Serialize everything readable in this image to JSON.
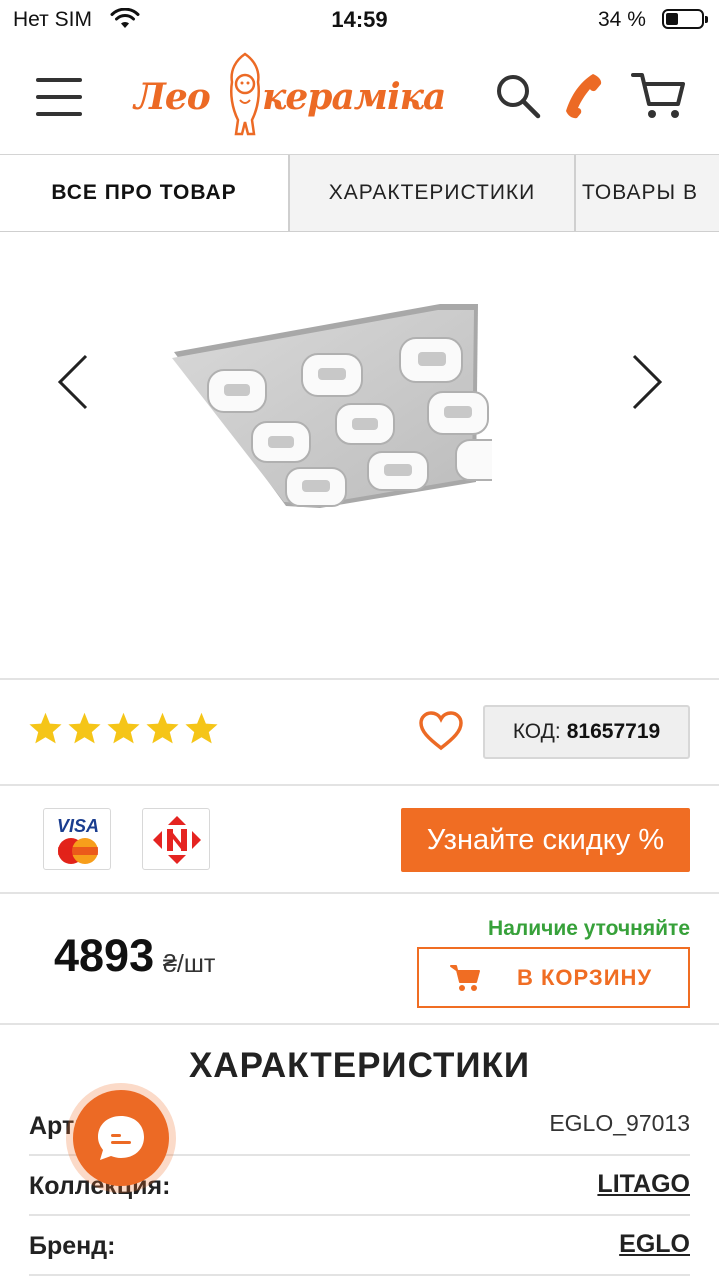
{
  "status_bar": {
    "carrier": "Нет SIM",
    "time": "14:59",
    "battery_percent": "34 %",
    "battery_level": 0.34
  },
  "header": {
    "logo_left": "Лео",
    "logo_right": "кераміка",
    "icons": [
      "menu-icon",
      "search-icon",
      "phone-icon",
      "cart-icon"
    ],
    "brand_color": "#ec6a25"
  },
  "tabs": [
    {
      "label": "ВСЕ ПРО ТОВАР",
      "active": true
    },
    {
      "label": "ХАРАКТЕРИСТИКИ",
      "active": false
    },
    {
      "label": "ТОВАРЫ В",
      "active": false
    }
  ],
  "gallery": {
    "prev_icon": "chevron-left-icon",
    "next_icon": "chevron-right-icon"
  },
  "product": {
    "rating": 5,
    "rating_max": 5,
    "star_color": "#f5c518",
    "code_label": "КОД:",
    "code_value": "81657719",
    "discount_label": "Узнайте скидку %",
    "price": "4893",
    "price_unit": "₴/шт",
    "availability": "Наличие уточняйте",
    "availability_color": "#37a13a",
    "add_to_cart": "В КОРЗИНУ",
    "payment_icons": [
      "visa-mastercard-icon",
      "nova-poshta-icon"
    ]
  },
  "characteristics": {
    "title": "ХАРАКТЕРИСТИКИ",
    "rows": [
      {
        "key": "Артикул:",
        "value": "EGLO_97013"
      },
      {
        "key": "Коллекция:",
        "value": "LITAGO"
      },
      {
        "key": "Бренд:",
        "value": "EGLO"
      }
    ]
  },
  "chat": {
    "icon": "chat-icon"
  }
}
